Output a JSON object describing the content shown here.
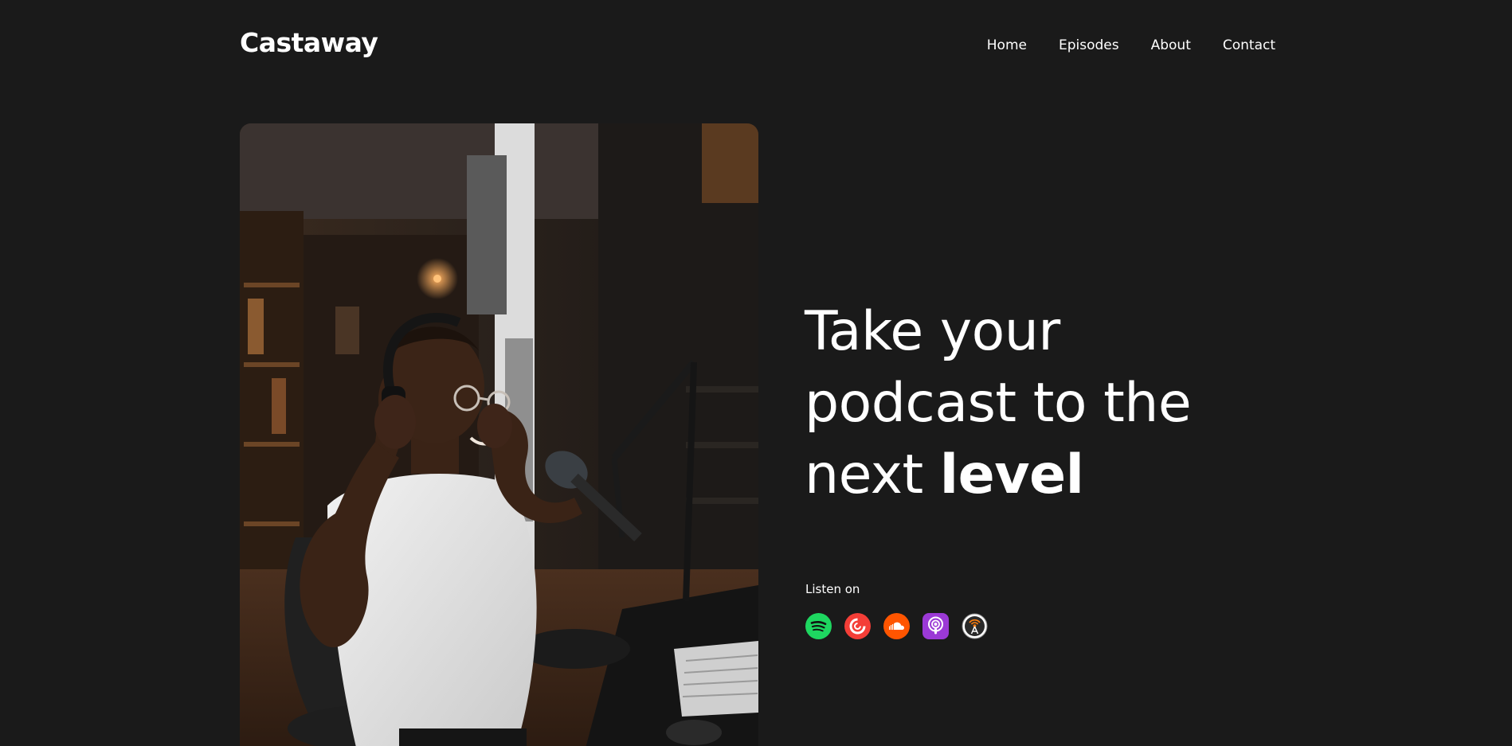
{
  "brand": {
    "name": "Castaway"
  },
  "nav": {
    "items": [
      {
        "label": "Home"
      },
      {
        "label": "Episodes"
      },
      {
        "label": "About"
      },
      {
        "label": "Contact"
      }
    ]
  },
  "hero": {
    "title_line1": "Take your",
    "title_line2": "podcast to the",
    "title_line3_regular": "next ",
    "title_line3_bold": "level",
    "image_icon": "podcaster-photo"
  },
  "listen": {
    "label": "Listen on",
    "platforms": [
      {
        "icon": "spotify-icon",
        "color": "#1ed760"
      },
      {
        "icon": "pocket-casts-icon",
        "color": "#f43e37"
      },
      {
        "icon": "soundcloud-icon",
        "color": "#ff5500"
      },
      {
        "icon": "apple-podcasts-icon",
        "color": "#9b39d6"
      },
      {
        "icon": "overcast-icon",
        "color": "#ffffff"
      }
    ]
  },
  "colors": {
    "background": "#1a1a1a",
    "text": "#ffffff"
  }
}
